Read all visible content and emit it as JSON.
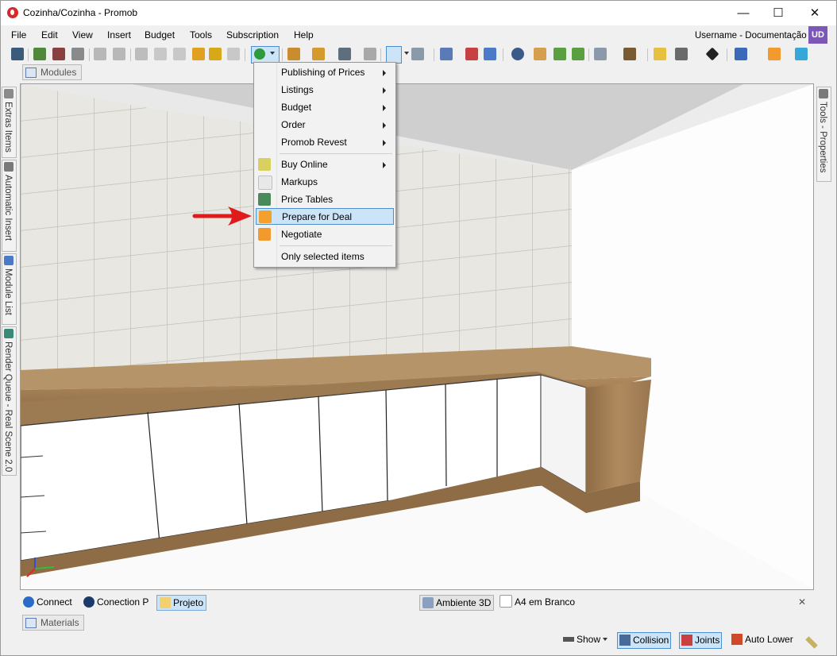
{
  "window": {
    "title": "Cozinha/Cozinha - Promob",
    "minimize_glyph": "—",
    "maximize_glyph": "☐",
    "close_glyph": "✕"
  },
  "menubar": {
    "items": [
      "File",
      "Edit",
      "View",
      "Insert",
      "Budget",
      "Tools",
      "Subscription",
      "Help"
    ],
    "user": "Username - Documentação",
    "user_initials": "UD"
  },
  "panels": {
    "modules_tab": "Modules",
    "materials_tab": "Materials",
    "tools_properties": "Tools - Properties",
    "left_tabs": [
      "Extras Items",
      "Automatic Insert",
      "Module List",
      "Render Queue - Real Scene 2.0"
    ]
  },
  "budget_menu": {
    "items": [
      {
        "label": "Publishing of Prices",
        "submenu": true,
        "icon": ""
      },
      {
        "label": "Listings",
        "submenu": true,
        "icon": ""
      },
      {
        "label": "Budget",
        "submenu": true,
        "icon": ""
      },
      {
        "label": "Order",
        "submenu": true,
        "icon": ""
      },
      {
        "label": "Promob Revest",
        "submenu": true,
        "icon": ""
      },
      {
        "label": "Buy Online",
        "submenu": true,
        "icon": "money-icon"
      },
      {
        "label": "Markups",
        "submenu": false,
        "icon": "markup-icon"
      },
      {
        "label": "Price Tables",
        "submenu": false,
        "icon": "price-table-icon"
      },
      {
        "label": "Prepare for Deal",
        "submenu": false,
        "icon": "save-deal-icon",
        "highlighted": true
      },
      {
        "label": "Negotiate",
        "submenu": false,
        "icon": "person-icon"
      },
      {
        "label": "Only selected items",
        "submenu": false,
        "icon": ""
      }
    ]
  },
  "bottom_tabs": {
    "connect": "Connect",
    "conection": "Conection P",
    "projeto": "Projeto",
    "ambiente": "Ambiente 3D",
    "a4": "A4 em Branco",
    "close_glyph": "✕"
  },
  "statusbar": {
    "show": "Show",
    "collision": "Collision",
    "joints": "Joints",
    "auto_lower": "Auto Lower"
  },
  "colors": {
    "accent": "#4f8fd0",
    "highlight": "#cce4f7",
    "arrow": "#e01b1b",
    "wood": "#a78358",
    "tile_wall": "#e6e5e0"
  }
}
